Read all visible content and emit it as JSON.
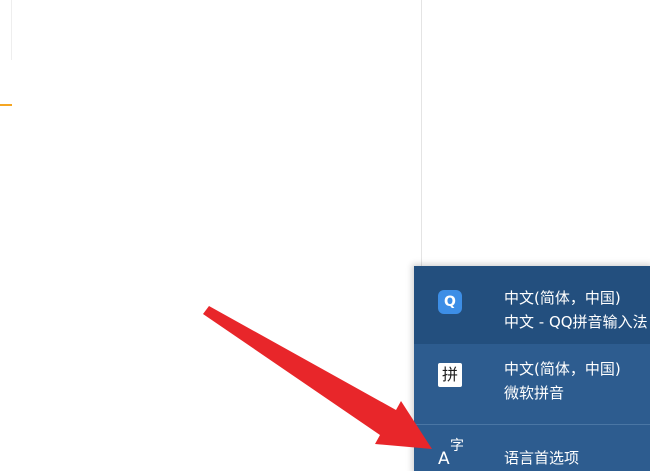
{
  "language_menu": {
    "items": [
      {
        "icon": "qq-pinyin-icon",
        "icon_glyph": "Q",
        "line1": "中文(简体，中国)",
        "line2": "中文 - QQ拼音输入法"
      },
      {
        "icon": "microsoft-pinyin-icon",
        "icon_glyph": "拼",
        "line1": "中文(简体，中国)",
        "line2": "微软拼音"
      },
      {
        "icon": "language-preferences-icon",
        "icon_glyph_a": "A",
        "icon_glyph_zi": "字",
        "line1": "语言首选项"
      }
    ]
  },
  "colors": {
    "menu_bg": "#2d5c8f",
    "menu_selected_bg": "#234f7e",
    "qq_icon_bg": "#3d8ee6",
    "arrow": "#e8262a",
    "accent_orange": "#f5a623"
  }
}
